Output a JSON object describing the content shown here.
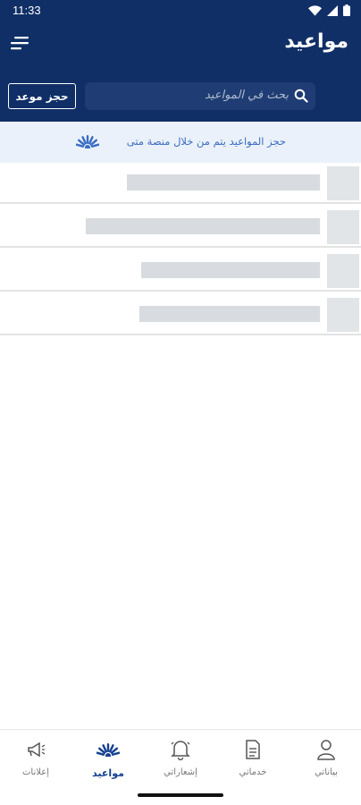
{
  "status": {
    "time": "11:33"
  },
  "header": {
    "title": "مواعيد"
  },
  "search": {
    "placeholder": "بحث في المواعيد",
    "book_label": "حجز موعد"
  },
  "banner": {
    "text": "حجز المواعيد يتم من خلال منصة متى"
  },
  "list": {
    "item_count": 4
  },
  "nav": {
    "items": [
      {
        "label": "بياناتي",
        "icon": "person-icon"
      },
      {
        "label": "خدماتي",
        "icon": "document-icon"
      },
      {
        "label": "إشعاراتي",
        "icon": "bell-icon"
      },
      {
        "label": "مواعيد",
        "icon": "appointments-icon",
        "active": true
      },
      {
        "label": "إعلانات",
        "icon": "megaphone-icon"
      }
    ]
  },
  "colors": {
    "primary": "#102f66",
    "accent": "#13408f",
    "banner_bg": "#eaf1fa"
  }
}
